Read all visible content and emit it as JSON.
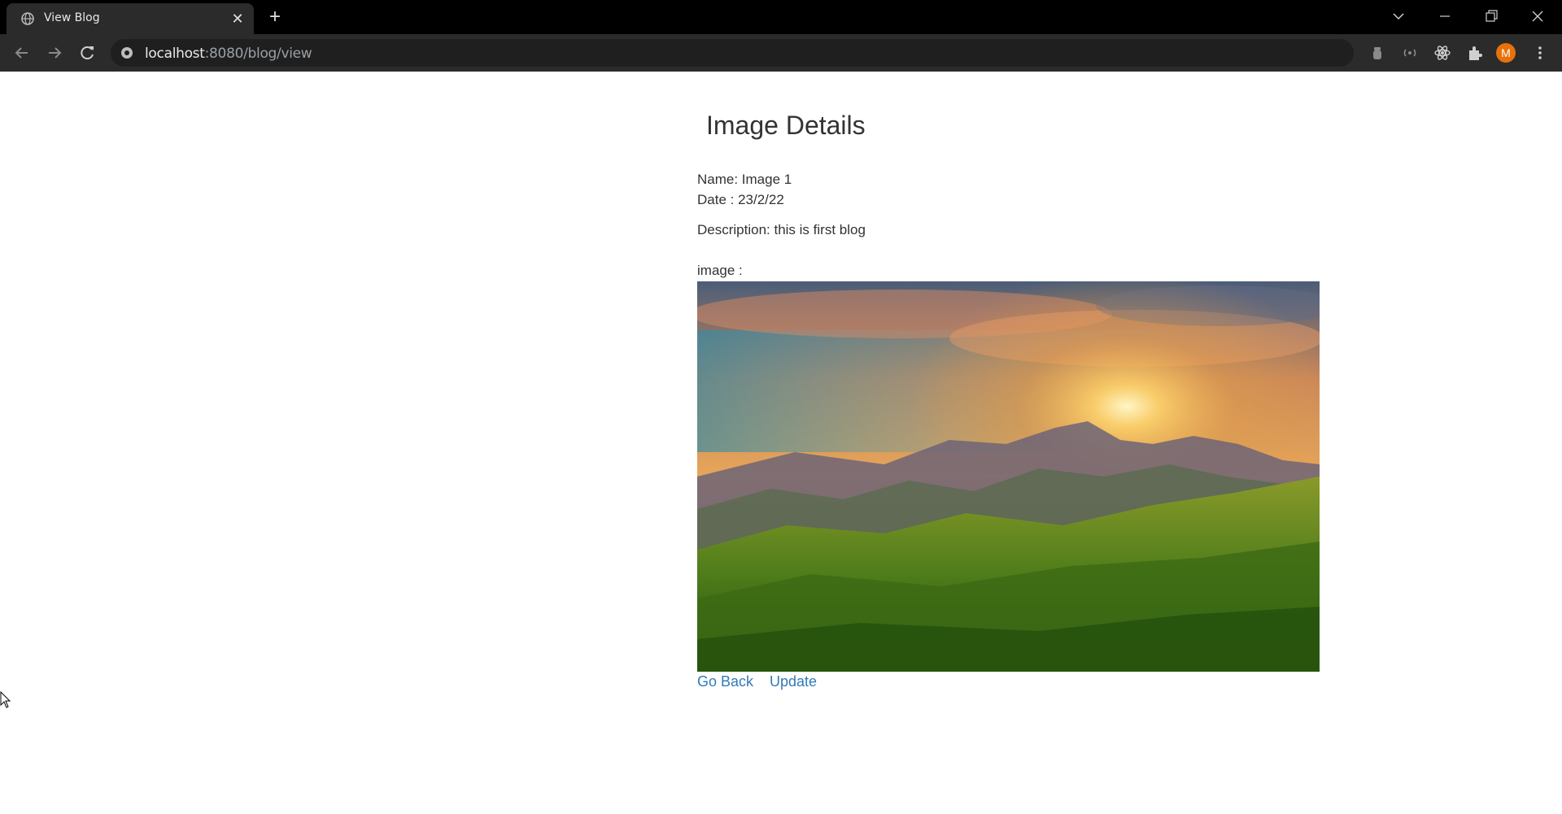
{
  "browser": {
    "tab_title": "View Blog",
    "url_host": "localhost",
    "url_path": ":8080/blog/view",
    "profile_initial": "M",
    "accent_profile_color": "#e8710a"
  },
  "page": {
    "title": "Image Details",
    "name_line": "Name: Image 1",
    "date_line": "Date : 23/2/22",
    "description_line": "Description: this is first blog",
    "image_label": "image :",
    "go_back_label": "Go Back",
    "update_label": "Update",
    "link_color": "#337ab7"
  }
}
